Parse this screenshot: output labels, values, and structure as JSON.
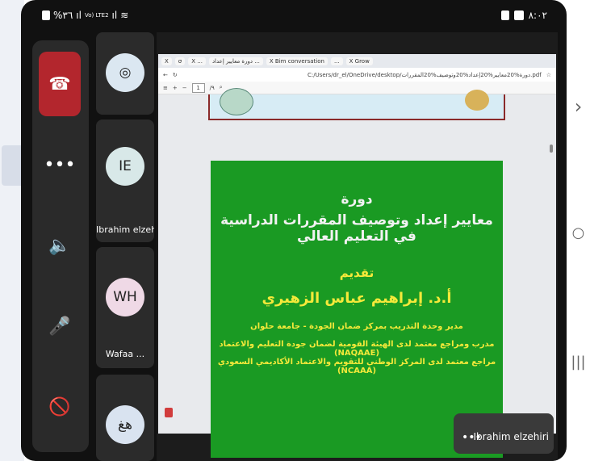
{
  "status": {
    "left_text": "%٣٦",
    "network_label": "Vo) LTE2",
    "time": "٨:٠٢"
  },
  "controls": [
    {
      "name": "end-call-button",
      "glyph": "☎"
    },
    {
      "name": "more-options-button",
      "glyph": "•••"
    },
    {
      "name": "speaker-button",
      "glyph": "🔈"
    },
    {
      "name": "mic-toggle-button",
      "glyph": "🎤"
    },
    {
      "name": "camera-toggle-button",
      "glyph": "🚫"
    }
  ],
  "participants": [
    {
      "initials": "",
      "label": "",
      "avatar_color": "#dbe7f1"
    },
    {
      "initials": "IE",
      "label": "Ibrahim elzeh...",
      "avatar_color": "#d8e8e8"
    },
    {
      "initials": "WH",
      "label": "Wafaa ...",
      "avatar_color": "#efd9e6"
    },
    {
      "initials": "هغ",
      "label": "",
      "avatar_color": "#d9e3f0"
    }
  ],
  "browser": {
    "tabs": [
      "X",
      "σ",
      "X ...",
      "دورة معايير إعداد ...",
      "X Bim conversation",
      "...",
      "X Grow"
    ],
    "url": "C:/Users/dr_el/OneDrive/desktop/دورة%20معايير%20إعداد%20وتوصيف%20المقررات.pdf",
    "page_number": "1",
    "page_total": "/٩"
  },
  "slide": {
    "course_label": "دورة",
    "title": "معايير إعداد وتوصيف المقررات الدراسية في التعليم العالي",
    "present_label": "تقديم",
    "presenter": "أ.د. إبراهيم عباس الزهيري",
    "line1": "مدير وحدة التدريب بمركز ضمان الجودة - جامعة حلوان",
    "line2": "مدرب ومراجع معتمد لدى الهيئة القومية لضمان جودة التعليم والاعتماد (NAQAAE)",
    "line3": "مراجع معتمد لدى المركز الوطني للتقويم والاعتماد الأكاديمي السعودي (NCAAA)"
  },
  "speaker": {
    "name": "Ibrahim elzehiri",
    "more": "•••"
  },
  "nav": {
    "forward": "›",
    "home": "○",
    "recents": "|||"
  }
}
